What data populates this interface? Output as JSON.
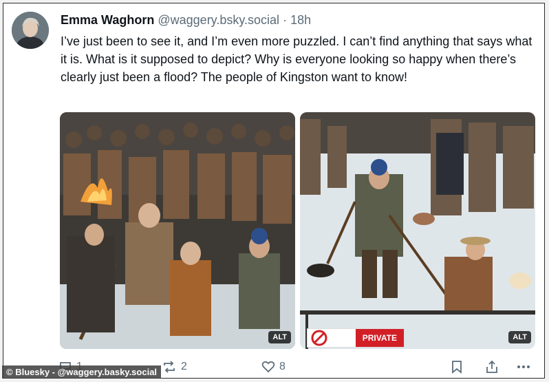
{
  "post": {
    "author": "Emma Waghorn",
    "handle": "@waggery.bsky.social",
    "separator": "·",
    "time": "18h",
    "text": "I’ve just been to see it, and I’m even more puzzled. I can’t find anything that says what it is. What is it supposed to depict? Why is everyone looking so happy when there’s clearly just been a flood? The people of Kingston want to know!"
  },
  "images": [
    {
      "alt_badge": "ALT"
    },
    {
      "alt_badge": "ALT",
      "sign_text": "PRIVATE"
    }
  ],
  "actions": {
    "reply_count": "1",
    "repost_count": "2",
    "like_count": "8"
  },
  "watermark": "© Bluesky - @waggery.basky.social",
  "colors": {
    "text": "#0f1419",
    "muted": "#5b6b78",
    "sign_red": "#d21f26",
    "flood_water": "#dfe6ea"
  },
  "icons": [
    "reply-icon",
    "repost-icon",
    "heart-icon",
    "bookmark-icon",
    "share-icon",
    "more-icon",
    "no-entry-icon"
  ]
}
